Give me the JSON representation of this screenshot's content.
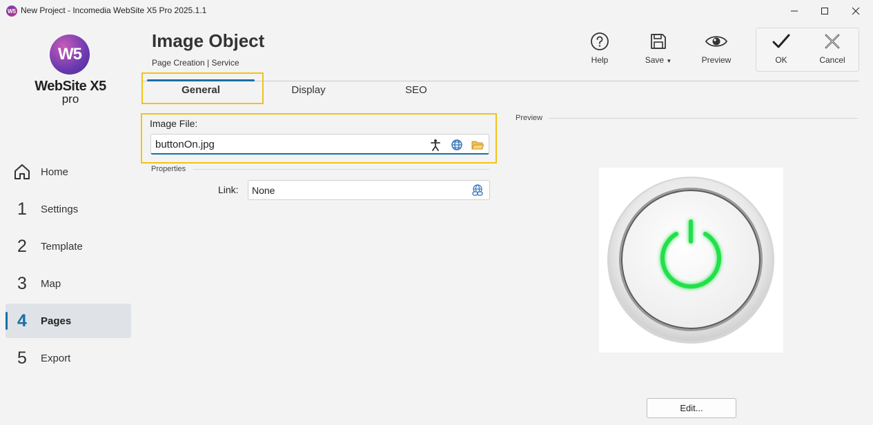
{
  "window": {
    "title": "New Project - Incomedia WebSite X5 Pro 2025.1.1",
    "app_icon_text": "W5"
  },
  "logo": {
    "badge": "W5",
    "name": "WebSite X5",
    "edition": "pro"
  },
  "sidebar": {
    "items": [
      {
        "num": "",
        "icon": "home-icon",
        "label": "Home"
      },
      {
        "num": "1",
        "label": "Settings"
      },
      {
        "num": "2",
        "label": "Template"
      },
      {
        "num": "3",
        "label": "Map"
      },
      {
        "num": "4",
        "label": "Pages",
        "active": true
      },
      {
        "num": "5",
        "label": "Export"
      }
    ]
  },
  "header": {
    "title": "Image Object",
    "breadcrumb": "Page Creation | Service"
  },
  "toolbar": {
    "help": "Help",
    "save": "Save",
    "preview": "Preview",
    "ok": "OK",
    "cancel": "Cancel"
  },
  "tabs": [
    "General",
    "Display",
    "SEO"
  ],
  "form": {
    "image_file_label": "Image File:",
    "image_file_value": "buttonOn.jpg",
    "properties_label": "Properties",
    "link_label": "Link:",
    "link_value": "None"
  },
  "preview": {
    "label": "Preview",
    "edit_button": "Edit..."
  },
  "colors": {
    "accent": "#1a6fa3",
    "highlight": "#f0c419",
    "power_green": "#22e04a"
  }
}
